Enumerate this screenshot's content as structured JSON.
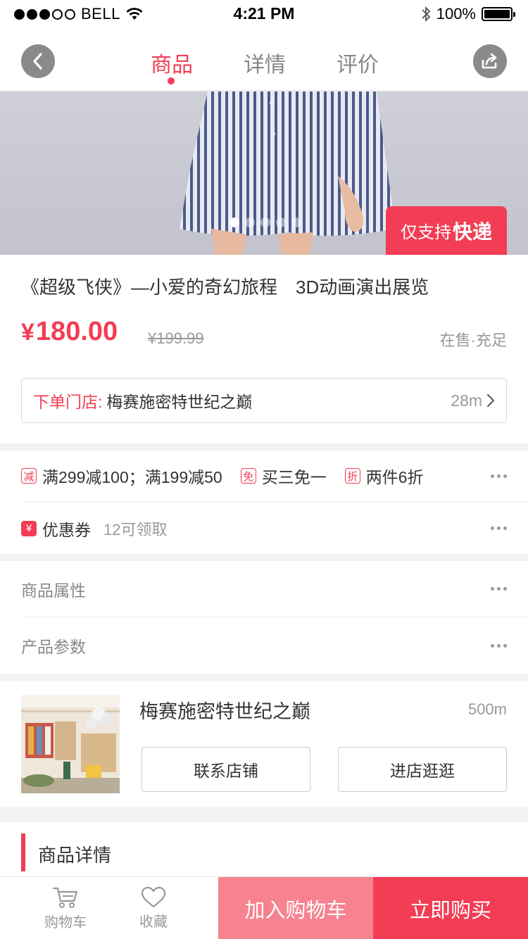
{
  "status_bar": {
    "carrier": "BELL",
    "time": "4:21 PM",
    "battery": "100%"
  },
  "nav": {
    "tabs": [
      {
        "label": "商品",
        "active": true
      },
      {
        "label": "详情",
        "active": false
      },
      {
        "label": "评价",
        "active": false
      }
    ],
    "back_icon": "chevron-left-icon",
    "share_icon": "share-icon"
  },
  "hero": {
    "express_prefix": "仅支持",
    "express_strong": "快递",
    "page_count": 5,
    "active_page": 1
  },
  "product": {
    "title": "《超级飞侠》—小爱的奇幻旅程　3D动画演出展览",
    "currency": "¥",
    "price": "180.00",
    "original_price": "¥199.99",
    "stock_status": "在售·充足",
    "store_label": "下单门店:",
    "store_name": "梅赛施密特世纪之巅",
    "store_distance": "28m"
  },
  "promotions": {
    "items": [
      {
        "badge": "减",
        "text": "满299减100；满199减50"
      },
      {
        "badge": "免",
        "text": "买三免一"
      },
      {
        "badge": "折",
        "text": "两件6折"
      }
    ],
    "coupon_badge": "¥",
    "coupon_label": "优惠券",
    "coupon_info": "12可领取"
  },
  "attributes": {
    "product_attrs": "商品属性",
    "product_params": "产品参数"
  },
  "shop": {
    "name": "梅赛施密特世纪之巅",
    "distance": "500m",
    "contact_label": "联系店铺",
    "visit_label": "进店逛逛"
  },
  "detail": {
    "title": "商品详情"
  },
  "bottom_bar": {
    "cart_label": "购物车",
    "fav_label": "收藏",
    "add_to_cart": "加入购物车",
    "buy_now": "立即购买"
  },
  "colors": {
    "accent": "#f23d54",
    "accent_light": "#f6838f",
    "muted": "#999999"
  }
}
